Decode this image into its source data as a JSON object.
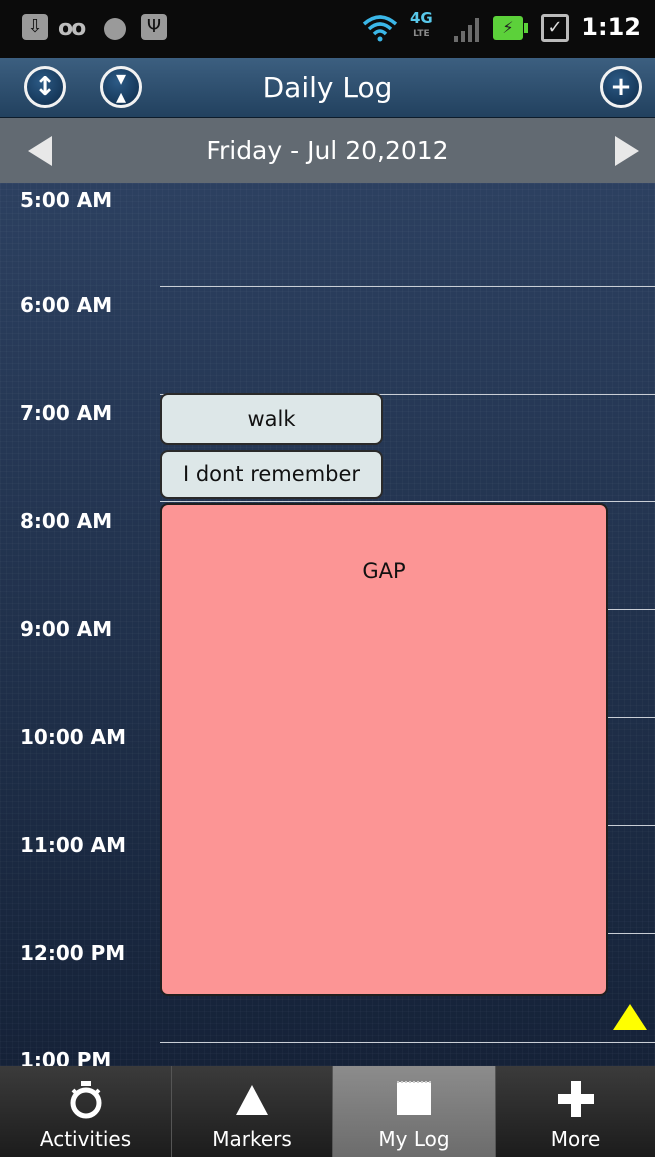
{
  "status_bar": {
    "time": "1:12",
    "network_label": "4G",
    "network_sub": "LTE",
    "icons": [
      "lock-icon",
      "voicemail-icon",
      "media-icon",
      "usb-icon",
      "wifi-icon",
      "signal-icon",
      "battery-charging-icon",
      "checkbox-icon"
    ]
  },
  "header": {
    "title": "Daily Log",
    "expand_icon": "expand-icon",
    "collapse_icon": "collapse-icon",
    "add_icon": "add-icon"
  },
  "date_nav": {
    "date": "Friday - Jul 20,2012"
  },
  "timeline": {
    "hours": [
      "5:00 AM",
      "6:00 AM",
      "7:00 AM",
      "8:00 AM",
      "9:00 AM",
      "10:00 AM",
      "11:00 AM",
      "12:00 PM",
      "1:00 PM"
    ],
    "events": [
      {
        "label": "walk"
      },
      {
        "label": "I dont remember"
      }
    ],
    "gap_label": "GAP",
    "marker_color": "#ffff00",
    "gap_color": "#fc9595"
  },
  "tabs": [
    {
      "label": "Activities",
      "icon": "stopwatch-icon",
      "active": false
    },
    {
      "label": "Markers",
      "icon": "triangle-icon",
      "active": false
    },
    {
      "label": "My Log",
      "icon": "notepad-icon",
      "active": true
    },
    {
      "label": "More",
      "icon": "plus-icon",
      "active": false
    }
  ]
}
